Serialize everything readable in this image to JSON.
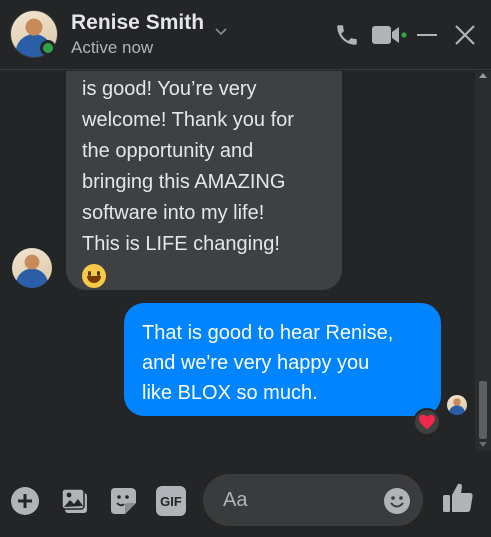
{
  "header": {
    "name": "Renise Smith",
    "status": "Active now",
    "icons": [
      "chevron-down-icon",
      "phone-icon",
      "video-icon",
      "minimize-icon",
      "close-icon"
    ]
  },
  "messages": {
    "incoming": {
      "lines": [
        "is good! You’re very",
        "welcome! Thank you for",
        "the opportunity and",
        "bringing this AMAZING",
        "software into my life!",
        "This is LIFE changing!"
      ],
      "emoji": "grinning-face-emoji"
    },
    "outgoing": {
      "lines": [
        "That is good to hear Renise,",
        "and we're very happy you",
        "like BLOX so much."
      ],
      "reaction": "heart"
    }
  },
  "composer": {
    "placeholder": "Aa",
    "icons": [
      "plus-icon",
      "photo-icon",
      "sticker-icon",
      "gif-icon",
      "emoji-icon",
      "thumbs-up-icon"
    ],
    "gif_label": "GIF"
  },
  "colors": {
    "background": "#242526",
    "incoming_bubble": "#3e4042",
    "outgoing_bubble": "#0084ff",
    "accent": "#0084ff",
    "online": "#31a24c"
  }
}
